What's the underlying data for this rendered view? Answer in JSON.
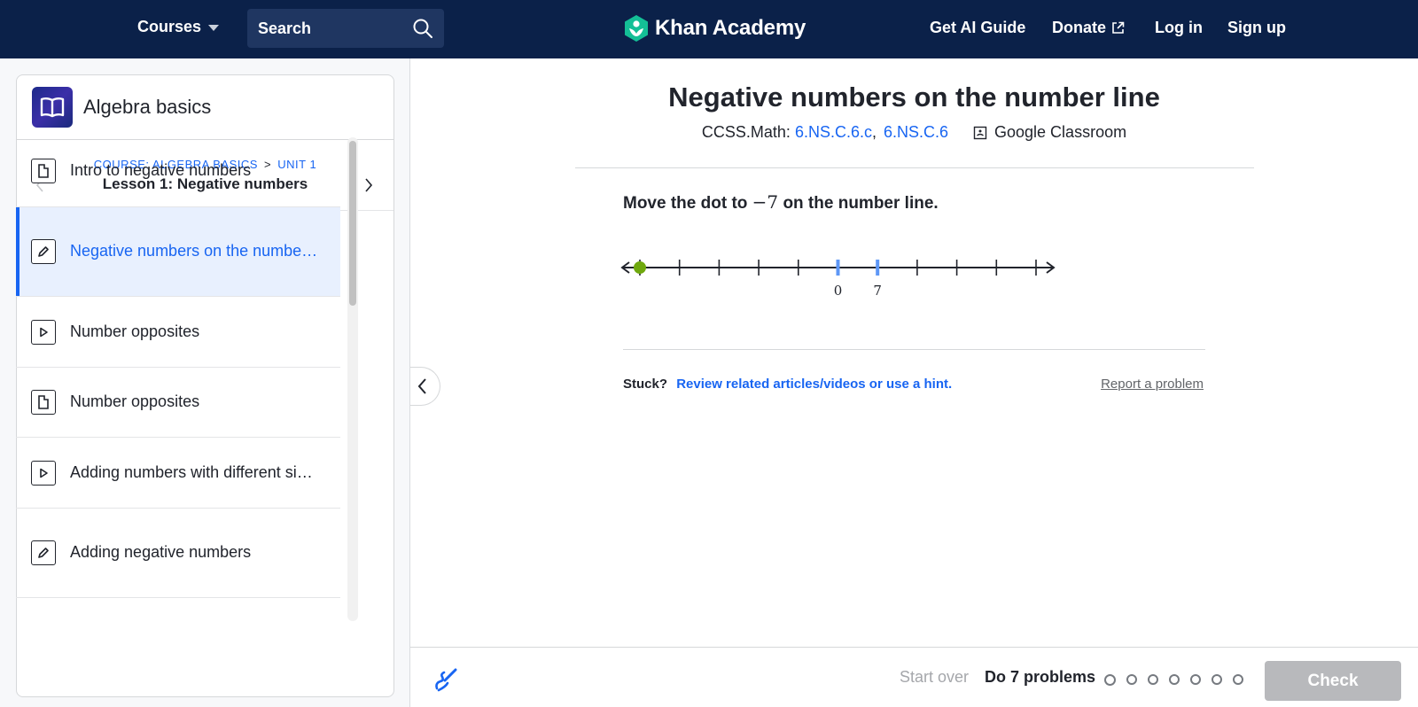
{
  "nav": {
    "courses_label": "Courses",
    "search_placeholder": "Search",
    "logo_text": "Khan Academy",
    "ai_guide": "Get AI Guide",
    "donate": "Donate",
    "login": "Log in",
    "signup": "Sign up",
    "bg_color": "#0b2149"
  },
  "sidebar": {
    "course_title": "Algebra basics",
    "breadcrumb_course": "COURSE: ALGEBRA BASICS",
    "breadcrumb_sep": ">",
    "breadcrumb_unit": "UNIT 1",
    "lesson_title": "Lesson 1: Negative numbers",
    "items": [
      {
        "label": "Intro to negative numbers",
        "icon": "article-icon",
        "active": false
      },
      {
        "label": "Negative numbers on the numbe…",
        "icon": "pencil-icon",
        "active": true
      },
      {
        "label": "Number opposites",
        "icon": "play-icon",
        "active": false
      },
      {
        "label": "Number opposites",
        "icon": "article-icon",
        "active": false
      },
      {
        "label": "Adding numbers with different si…",
        "icon": "play-icon",
        "active": false
      },
      {
        "label": "Adding negative numbers",
        "icon": "pencil-icon",
        "active": false
      }
    ]
  },
  "main": {
    "title": "Negative numbers on the number line",
    "ccss_prefix": "CCSS.Math:",
    "standard_1": "6.NS.C.6.c",
    "comma": ",",
    "standard_2": "6.NS.C.6",
    "classroom": "Google Classroom",
    "question_pre": "Move the dot to",
    "question_math": "−7",
    "question_post": "on the number line.",
    "number_line": {
      "tick_count": 11,
      "labels": [
        {
          "tick": 5,
          "text": "0"
        },
        {
          "tick": 6,
          "text": "7"
        }
      ],
      "highlight_ticks": [
        5,
        6
      ],
      "dot_tick": 0,
      "dot_color": "#6fa80e",
      "highlight_color": "#5e97f6"
    },
    "stuck_label": "Stuck?",
    "hint_link": "Review related articles/videos or use a hint.",
    "report": "Report a problem"
  },
  "footer": {
    "start_over": "Start over",
    "do_problems": "Do 7 problems",
    "problem_dots": 7,
    "check": "Check"
  },
  "colors": {
    "accent": "#1865f2",
    "check_disabled": "#b8b9bc"
  }
}
